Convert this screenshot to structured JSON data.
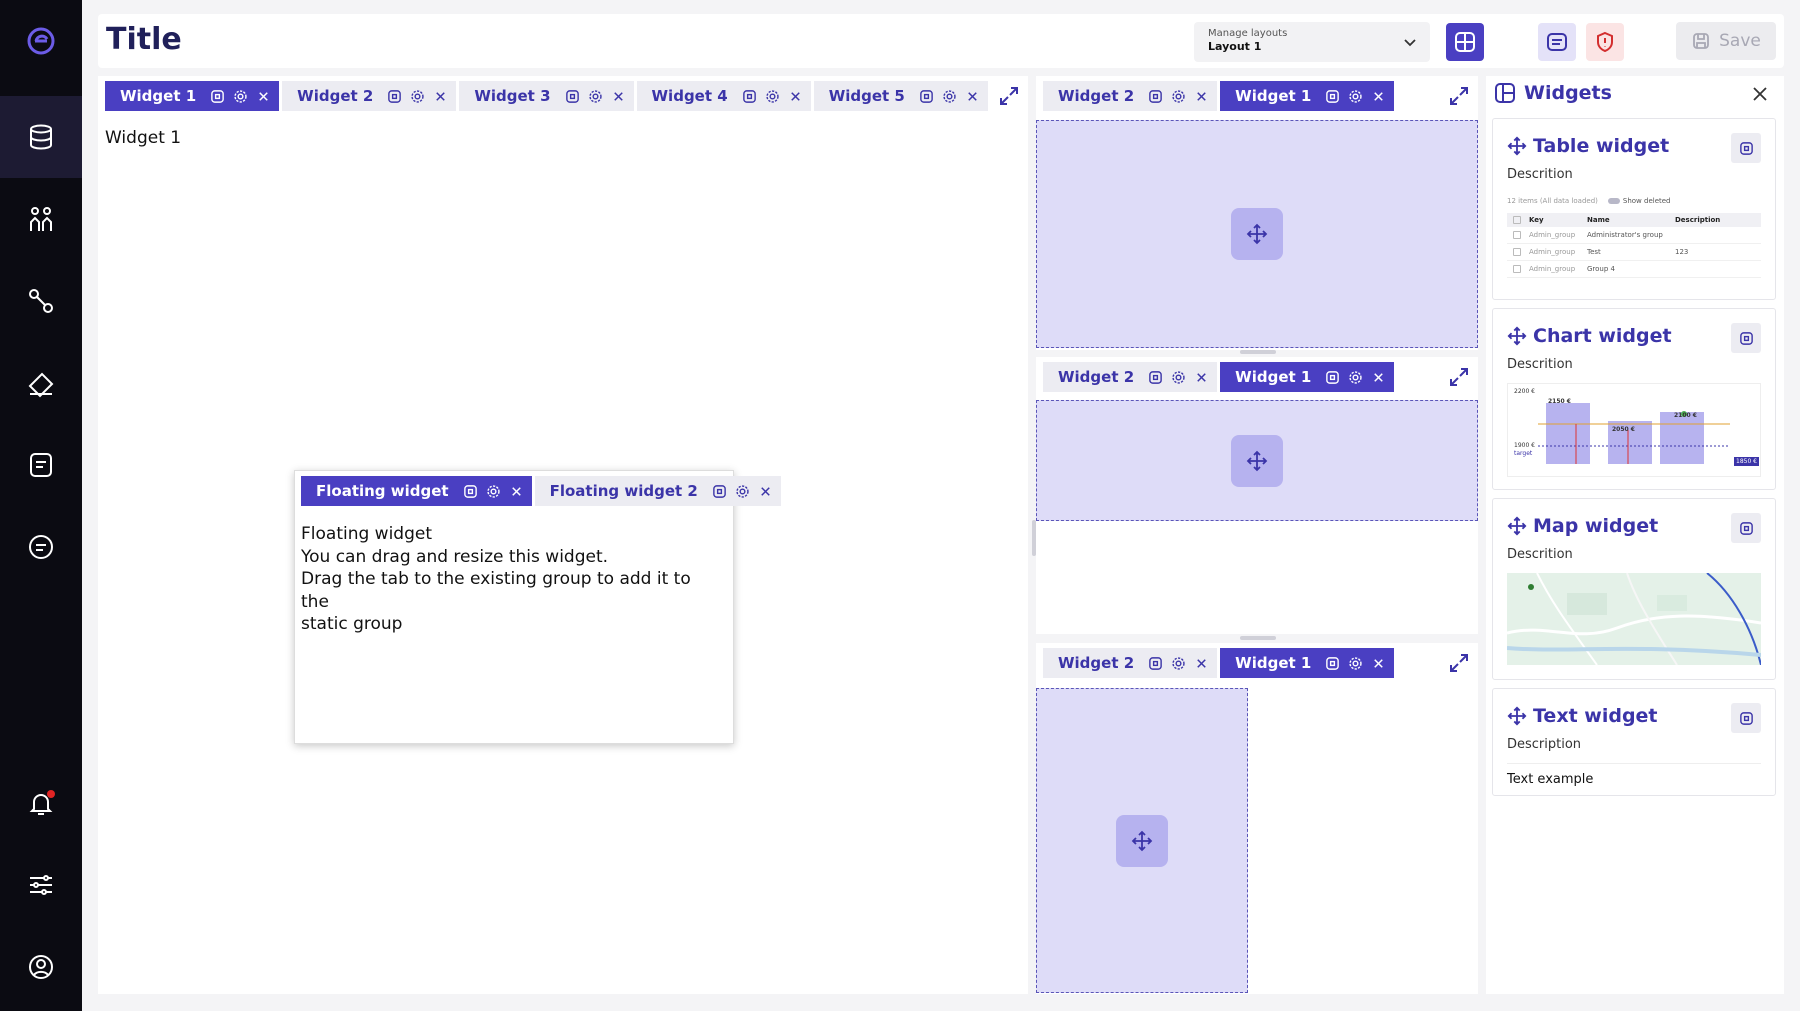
{
  "sidebar": {
    "items": [
      {
        "icon": "logo-icon"
      },
      {
        "icon": "database-icon"
      },
      {
        "icon": "users-icon"
      },
      {
        "icon": "route-icon"
      },
      {
        "icon": "eraser-icon"
      },
      {
        "icon": "document-icon"
      },
      {
        "icon": "chat-icon"
      },
      {
        "icon": "bell-icon"
      },
      {
        "icon": "sliders-icon"
      },
      {
        "icon": "user-circle-icon"
      }
    ],
    "colors": {
      "background": "#0b0b12",
      "active": "#1d1b33",
      "accent": "#6c5ce7"
    }
  },
  "header": {
    "title": "Title",
    "layout_select": {
      "label": "Manage layouts",
      "value": "Layout 1"
    },
    "save_label": "Save"
  },
  "main": {
    "tabs": [
      "Widget 1",
      "Widget 2",
      "Widget 3",
      "Widget 4",
      "Widget 5"
    ],
    "active_tab": "Widget 1",
    "content": "Widget 1"
  },
  "floating": {
    "tabs": [
      "Floating widget",
      "Floating widget 2"
    ],
    "lines": [
      "Floating widget",
      "You can drag and resize this widget.",
      "Drag the tab to the existing group to add it to the",
      "static group"
    ]
  },
  "right_groups": [
    {
      "tabs": [
        "Widget 2",
        "Widget 1"
      ],
      "active": "Widget 1"
    },
    {
      "tabs": [
        "Widget 2",
        "Widget 1"
      ],
      "active": "Widget 1"
    },
    {
      "tabs": [
        "Widget 2",
        "Widget 1"
      ],
      "active": "Widget 1"
    }
  ],
  "widgets_panel": {
    "title": "Widgets",
    "cards": [
      {
        "title": "Table widget",
        "description": "Descrition"
      },
      {
        "title": "Chart widget",
        "description": "Descrition"
      },
      {
        "title": "Map widget",
        "description": "Descrition"
      },
      {
        "title": "Text widget",
        "description": "Description"
      }
    ],
    "table_preview": {
      "summary": "12 items (All data loaded)",
      "toggle_label": "Show deleted",
      "columns": [
        "Key",
        "Name",
        "Description"
      ],
      "rows": [
        [
          "Admin_group",
          "Administrator's group",
          ""
        ],
        [
          "Admin_group",
          "Test",
          "123"
        ],
        [
          "Admin_group",
          "Group 4",
          ""
        ]
      ]
    },
    "chart_preview": {
      "y_top": "2200 €",
      "target": "1900 €",
      "target_label": "target",
      "bars": [
        {
          "label": "2150 €",
          "value": 2150
        },
        {
          "label": "2050 €",
          "value": 2050
        },
        {
          "label": "2100 €",
          "value": 2100
        }
      ],
      "badge": "1850 €"
    },
    "text_example": "Text example"
  },
  "colors": {
    "primary": "#4a3fc2",
    "primary_text": "#3b34a8",
    "dropzone": "#dedcf8",
    "tab_inactive": "#ececf2"
  }
}
